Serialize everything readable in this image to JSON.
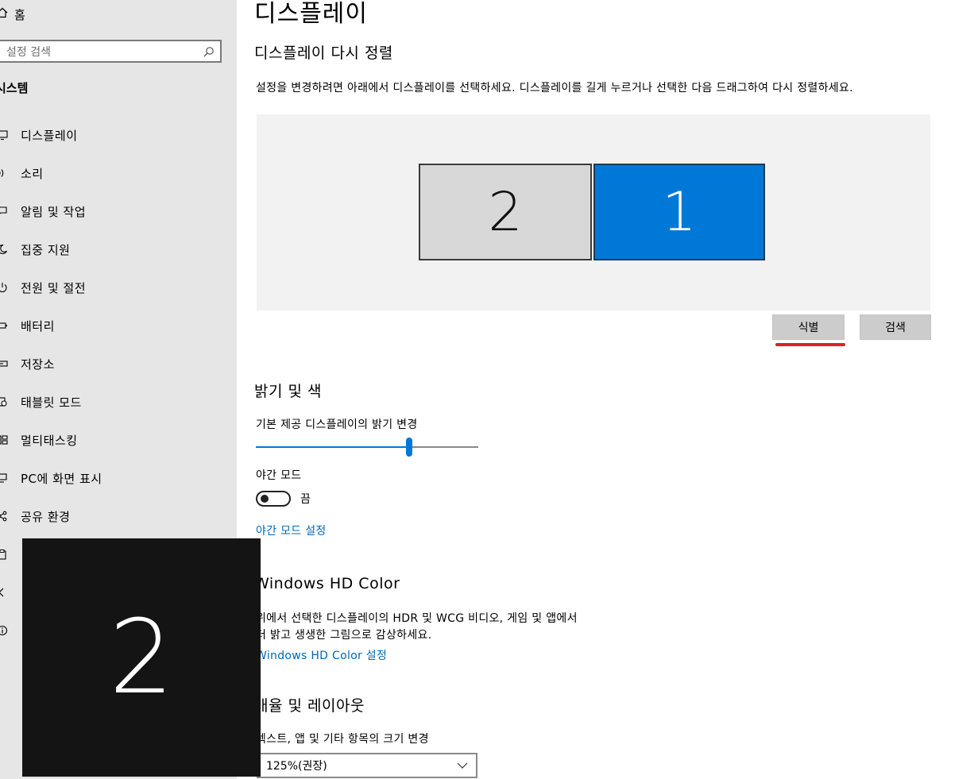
{
  "sidebar": {
    "home_label": "홈",
    "search_placeholder": "설정 검색",
    "section": "시스템",
    "items": [
      {
        "label": "디스플레이",
        "icon": "display-icon"
      },
      {
        "label": "소리",
        "icon": "speaker-icon"
      },
      {
        "label": "알림 및 작업",
        "icon": "notification-icon"
      },
      {
        "label": "집중 지원",
        "icon": "moon-icon"
      },
      {
        "label": "전원 및 절전",
        "icon": "power-icon"
      },
      {
        "label": "배터리",
        "icon": "battery-icon"
      },
      {
        "label": "저장소",
        "icon": "storage-icon"
      },
      {
        "label": "태블릿 모드",
        "icon": "tablet-icon"
      },
      {
        "label": "멀티태스킹",
        "icon": "multitask-icon"
      },
      {
        "label": "PC에 화면 표시",
        "icon": "project-icon"
      },
      {
        "label": "공유 환경",
        "icon": "share-icon"
      },
      {
        "label": "",
        "icon": "clipboard-icon"
      },
      {
        "label": "",
        "icon": "remote-icon"
      },
      {
        "label": "",
        "icon": "info-icon"
      }
    ]
  },
  "main": {
    "title": "디스플레이",
    "rearrange_heading": "디스플레이 다시 정렬",
    "rearrange_desc": "설정을 변경하려면 아래에서 디스플레이를 선택하세요. 디스플레이를 길게 누르거나 선택한 다음 드래그하여 다시 정렬하세요.",
    "monitors": [
      {
        "number": "2",
        "selected": false
      },
      {
        "number": "1",
        "selected": true
      }
    ],
    "identify_label": "식별",
    "detect_label": "검색",
    "brightness_heading": "밝기 및 색",
    "brightness_label": "기본 제공 디스플레이의 밝기 변경",
    "brightness_value": 0.69,
    "night_mode_label": "야간 모드",
    "night_mode_state": "끔",
    "night_mode_link": "야간 모드 설정",
    "hd_heading": "Windows HD Color",
    "hd_desc_1": "위에서 선택한 디스플레이의 HDR 및 WCG 비디오, 게임 및 앱에서",
    "hd_desc_2": "더 밝고 생생한 그림으로 감상하세요.",
    "hd_link": "Windows HD Color 설정",
    "scale_heading": "배율 및 레이아웃",
    "scale_label": "텍스트, 앱 및 기타 항목의 크기 변경",
    "scale_value": "125%(권장)"
  },
  "overlay": {
    "number": "2"
  },
  "colors": {
    "accent": "#0078d7",
    "sidebar_bg": "#e6e6e6",
    "highlight": "#e02020"
  }
}
